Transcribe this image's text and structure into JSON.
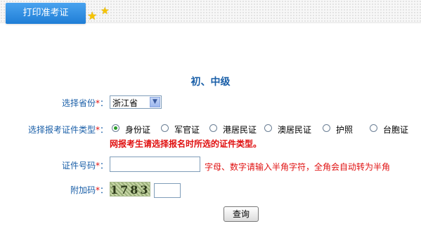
{
  "header": {
    "tab_label": "打印准考证"
  },
  "main": {
    "title": "初、中级",
    "province": {
      "label": "选择省份",
      "required_mark": "*",
      "colon": "：",
      "selected": "浙江省"
    },
    "id_type": {
      "label": "选择报考证件类型",
      "required_mark": "*",
      "colon": "：",
      "options": [
        "身份证",
        "军官证",
        "港居民证",
        "澳居民证",
        "护照",
        "台胞证"
      ],
      "selected_index": 0,
      "warning": "网报考生请选择报名时所选的证件类型。"
    },
    "id_number": {
      "label": "证件号码",
      "required_mark": "*",
      "colon": "：",
      "value": "",
      "hint": "字母、数字请输入半角字符，全角会自动转为半角"
    },
    "captcha": {
      "label": "附加码",
      "required_mark": "*",
      "colon": "：",
      "image_text": "1783",
      "value": ""
    },
    "submit_label": "查询"
  },
  "colors": {
    "accent": "#1a5fa8",
    "warning": "#e01010",
    "tab": "#2b8de2"
  }
}
